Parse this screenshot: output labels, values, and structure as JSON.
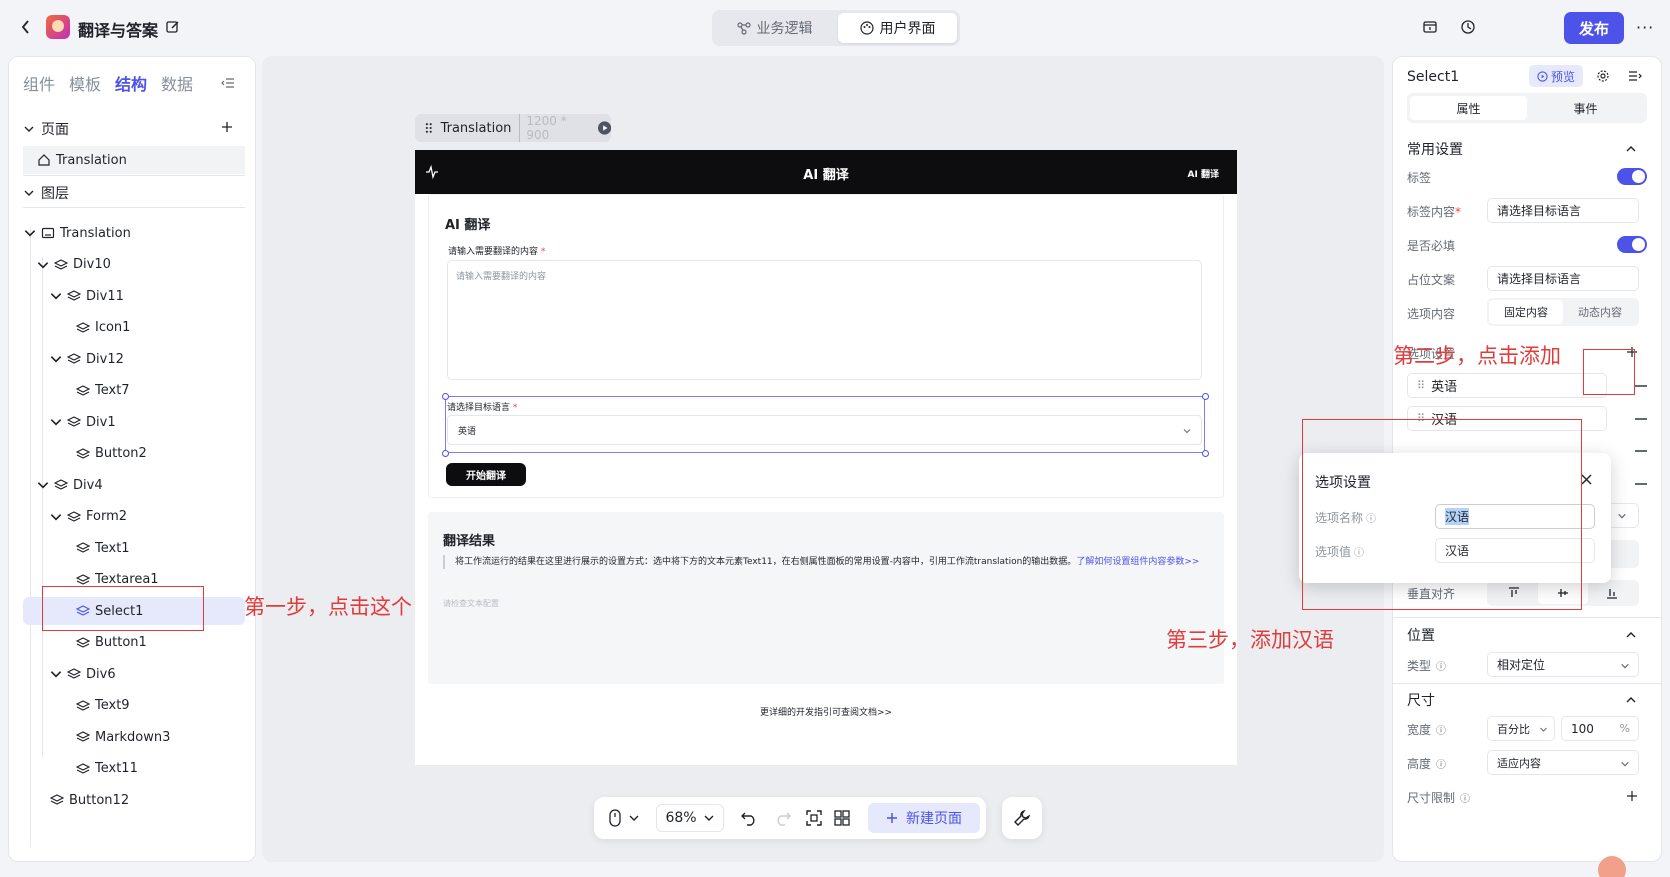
{
  "header": {
    "app_title": "翻译与答案",
    "tabs": [
      {
        "label": "业务逻辑"
      },
      {
        "label": "用户界面"
      }
    ],
    "publish_label": "发布"
  },
  "left_panel": {
    "tabs": [
      "组件",
      "模板",
      "结构",
      "数据"
    ],
    "pages_label": "页面",
    "page_item": "Translation",
    "layers_label": "图层",
    "tree": [
      {
        "label": "Translation",
        "depth": 0,
        "icon": "frame"
      },
      {
        "label": "Div10",
        "depth": 1
      },
      {
        "label": "Div11",
        "depth": 2
      },
      {
        "label": "Icon1",
        "depth": 3
      },
      {
        "label": "Div12",
        "depth": 2
      },
      {
        "label": "Text7",
        "depth": 3
      },
      {
        "label": "Div1",
        "depth": 2
      },
      {
        "label": "Button2",
        "depth": 3
      },
      {
        "label": "Div4",
        "depth": 1
      },
      {
        "label": "Form2",
        "depth": 2
      },
      {
        "label": "Text1",
        "depth": 3
      },
      {
        "label": "Textarea1",
        "depth": 3
      },
      {
        "label": "Select1",
        "depth": 3,
        "selected": true
      },
      {
        "label": "Button1",
        "depth": 3
      },
      {
        "label": "Div6",
        "depth": 2
      },
      {
        "label": "Text9",
        "depth": 3
      },
      {
        "label": "Markdown3",
        "depth": 3
      },
      {
        "label": "Text11",
        "depth": 3
      },
      {
        "label": "Button12",
        "depth": 1
      }
    ]
  },
  "canvas": {
    "frame_name": "Translation",
    "frame_size": "1200 * 900",
    "app_header_title": "AI 翻译",
    "app_header_right": "AI 翻译",
    "form_title": "AI 翻译",
    "input_label": "请输入需要翻译的内容",
    "input_placeholder": "请输入需要翻译的内容",
    "select_label": "请选择目标语言",
    "select_value": "英语",
    "submit_label": "开始翻译",
    "result_title": "翻译结果",
    "result_desc": "将工作流运行的结果在这里进行展示的设置方式：选中将下方的文本元素Text11，在右侧属性面板的常用设置-内容中，引用工作流translation的输出数据。",
    "result_link": "了解如何设置组件内容参数>>",
    "result_placeholder": "请检查文本配置",
    "footer_link": "更详细的开发指引可查阅文档>>",
    "zoom": "68%",
    "new_page_label": "新建页面"
  },
  "right_panel": {
    "component_name": "Select1",
    "preview_label": "预览",
    "tabs": [
      "属性",
      "事件"
    ],
    "common_settings_label": "常用设置",
    "label_label": "标签",
    "label_content_label": "标签内容",
    "label_content_value": "请选择目标语言",
    "required_label": "是否必填",
    "placeholder_label": "占位文案",
    "placeholder_value": "请选择目标语言",
    "options_content_label": "选项内容",
    "options_mode": [
      "固定内容",
      "动态内容"
    ],
    "options_settings_label": "选项设置",
    "options": [
      "英语",
      "汉语"
    ],
    "vertical_align_label": "垂直对齐",
    "position_section": "位置",
    "type_label": "类型",
    "type_value": "相对定位",
    "size_section": "尺寸",
    "width_label": "宽度",
    "width_unit_mode": "百分比",
    "width_value": "100",
    "width_unit": "%",
    "height_label": "高度",
    "height_value": "适应内容",
    "size_limit_label": "尺寸限制"
  },
  "popup": {
    "title": "选项设置",
    "name_label": "选项名称",
    "name_value": "汉语",
    "value_label": "选项值",
    "value_value": "汉语"
  },
  "annotations": {
    "step1": "第一步，点击这个",
    "step2": "第二步，点击添加",
    "step3": "第三步，添加汉语"
  },
  "colors": {
    "accent": "#4d53e8",
    "annotation": "#e23b3b",
    "dark": "#0d0d0f"
  }
}
